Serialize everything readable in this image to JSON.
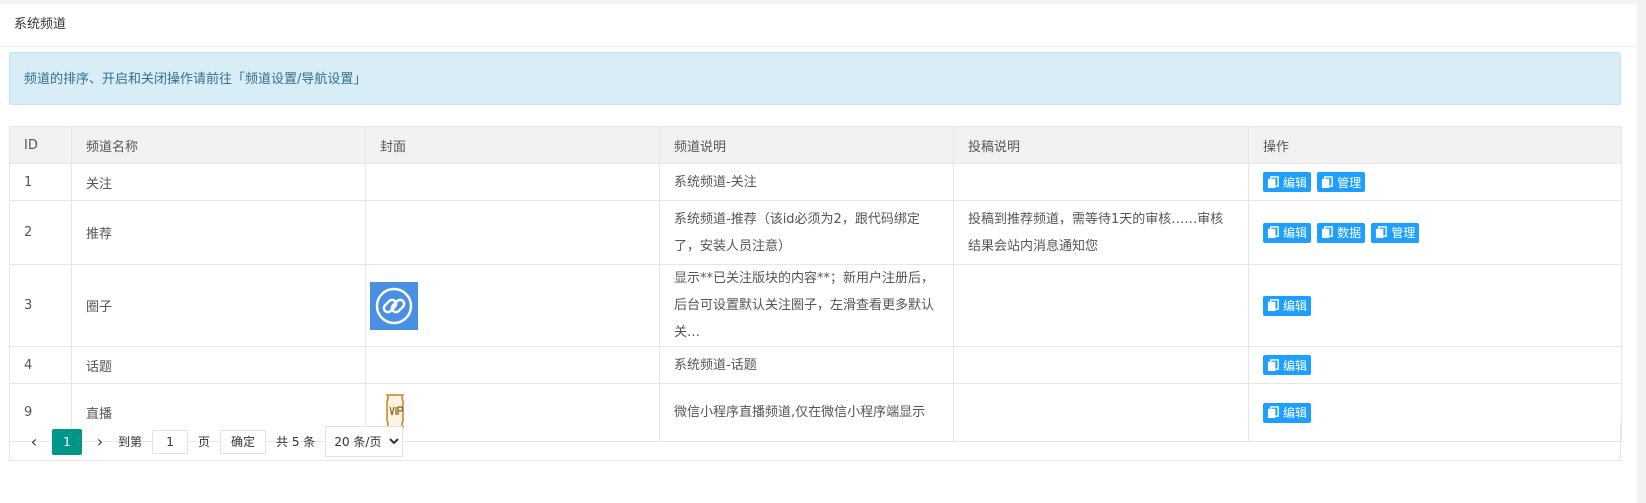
{
  "panel": {
    "title": "系统频道"
  },
  "notice": {
    "text": "频道的排序、开启和关闭操作请前往「频道设置/导航设置」"
  },
  "table": {
    "headers": [
      "ID",
      "频道名称",
      "封面",
      "频道说明",
      "投稿说明",
      "操作"
    ],
    "rows": [
      {
        "id": "1",
        "name": "关注",
        "cover": "",
        "desc": "系统频道-关注",
        "submit": "",
        "actions": [
          "编辑",
          "管理"
        ]
      },
      {
        "id": "2",
        "name": "推荐",
        "cover": "",
        "desc": "系统频道-推荐（该id必须为2，跟代码绑定了，安装人员注意）",
        "submit": "投稿到推荐频道，需等待1天的审核……审核结果会站内消息通知您",
        "actions": [
          "编辑",
          "数据",
          "管理"
        ]
      },
      {
        "id": "3",
        "name": "圈子",
        "cover": "link-icon",
        "desc": "显示**已关注版块的内容**；新用户注册后，后台可设置默认关注圈子，左滑查看更多默认关…",
        "submit": "",
        "actions": [
          "编辑"
        ]
      },
      {
        "id": "4",
        "name": "话题",
        "cover": "",
        "desc": "系统频道-话题",
        "submit": "",
        "actions": [
          "编辑"
        ]
      },
      {
        "id": "9",
        "name": "直播",
        "cover": "vip-ticket-icon",
        "desc": "微信小程序直播频道,仅在微信小程序端显示",
        "submit": "",
        "actions": [
          "编辑"
        ]
      }
    ]
  },
  "pager": {
    "current": "1",
    "goto_label": "到第",
    "page_input": "1",
    "page_unit": "页",
    "confirm": "确定",
    "total": "共 5 条",
    "page_size": "20 条/页"
  },
  "colors": {
    "button": "#1e9fff",
    "pager_active": "#009688",
    "notice_bg": "#d9edf7",
    "notice_text": "#31708f"
  }
}
